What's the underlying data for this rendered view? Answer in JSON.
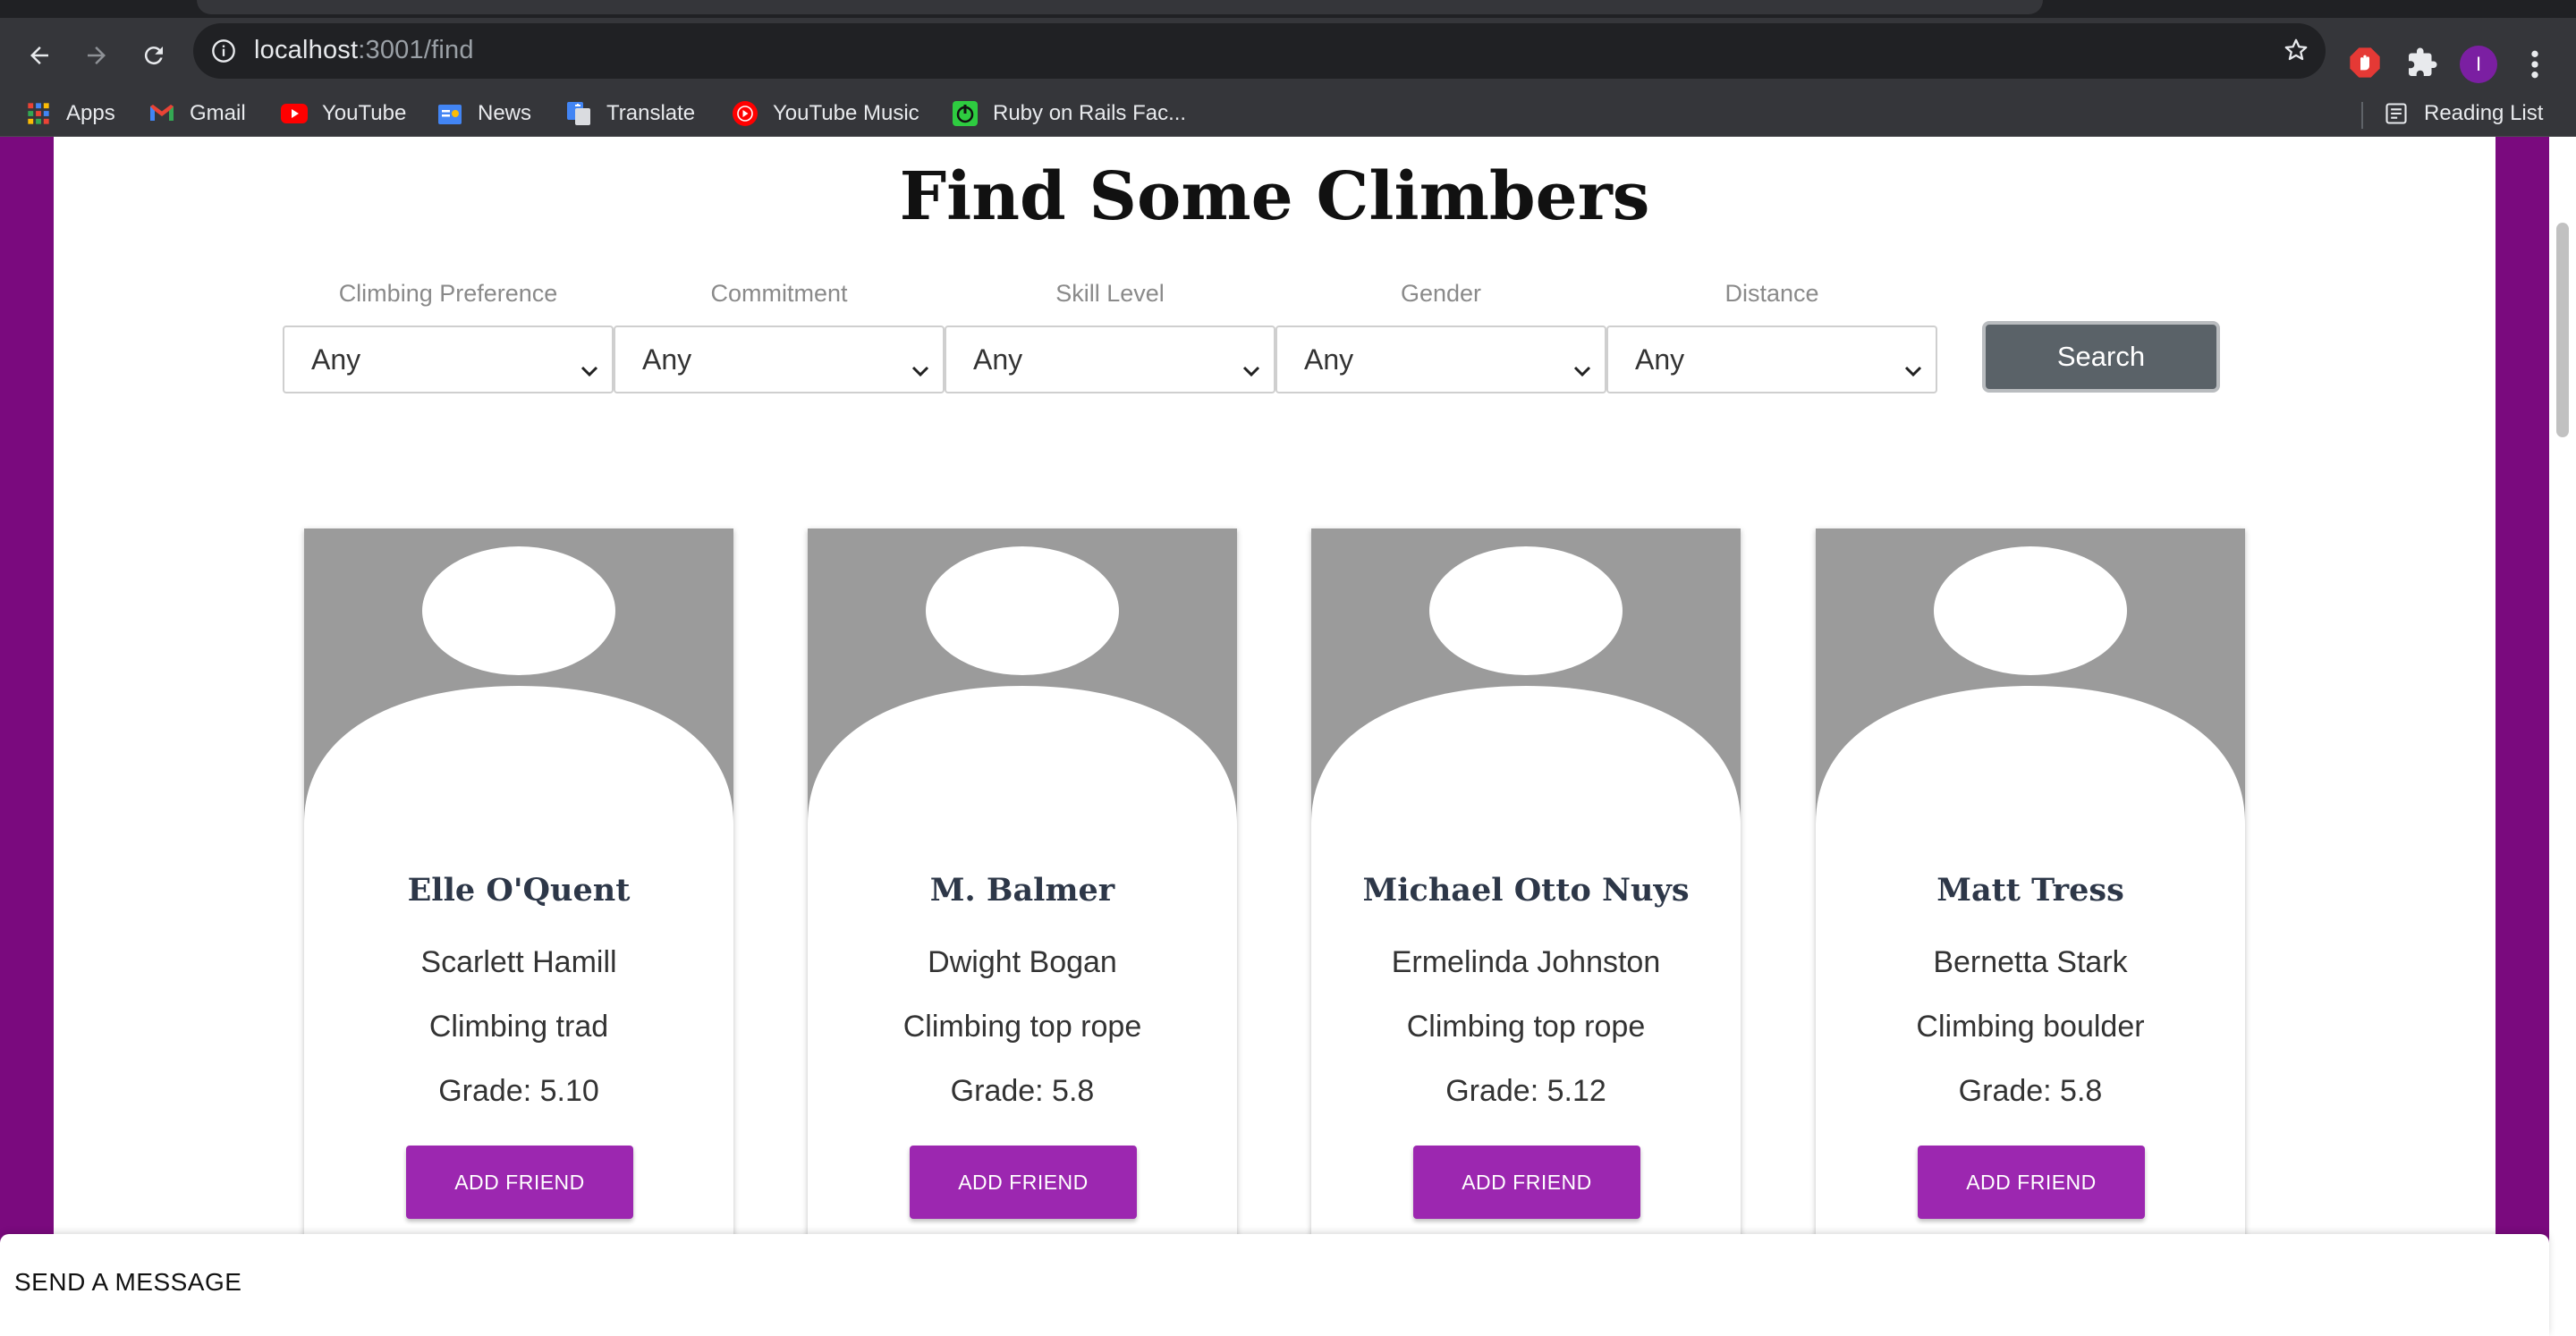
{
  "browser": {
    "url_host": "localhost",
    "url_path": ":3001/find",
    "profile_initial": "I",
    "bookmarks": [
      {
        "label": "Apps",
        "icon": "apps-grid-icon"
      },
      {
        "label": "Gmail",
        "icon": "gmail-icon"
      },
      {
        "label": "YouTube",
        "icon": "youtube-icon"
      },
      {
        "label": "News",
        "icon": "google-news-icon"
      },
      {
        "label": "Translate",
        "icon": "google-translate-icon"
      },
      {
        "label": "YouTube Music",
        "icon": "youtube-music-icon"
      },
      {
        "label": "Ruby on Rails Fac...",
        "icon": "power-icon"
      }
    ],
    "reading_list": "Reading List"
  },
  "page": {
    "title": "Find Some Climbers",
    "filters": [
      {
        "label": "Climbing Preference",
        "value": "Any"
      },
      {
        "label": "Commitment",
        "value": "Any"
      },
      {
        "label": "Skill Level",
        "value": "Any"
      },
      {
        "label": "Gender",
        "value": "Any"
      },
      {
        "label": "Distance",
        "value": "Any"
      }
    ],
    "search_label": "Search",
    "climbers": [
      {
        "username": "Elle O'Quent",
        "name": "Scarlett Hamill",
        "style": "Climbing trad",
        "grade": "Grade: 5.10",
        "button": "ADD FRIEND"
      },
      {
        "username": "M. Balmer",
        "name": "Dwight Bogan",
        "style": "Climbing top rope",
        "grade": "Grade: 5.8",
        "button": "ADD FRIEND"
      },
      {
        "username": "Michael Otto Nuys",
        "name": "Ermelinda Johnston",
        "style": "Climbing top rope",
        "grade": "Grade: 5.12",
        "button": "ADD FRIEND"
      },
      {
        "username": "Matt Tress",
        "name": "Bernetta Stark",
        "style": "Climbing boulder",
        "grade": "Grade: 5.8",
        "button": "ADD FRIEND"
      }
    ],
    "message_bar": "SEND A MESSAGE"
  },
  "colors": {
    "page_background": "#7a0a7e",
    "accent": "#9c27b0",
    "search_button": "#5a6268",
    "avatar_gray": "#9b9b9b"
  }
}
